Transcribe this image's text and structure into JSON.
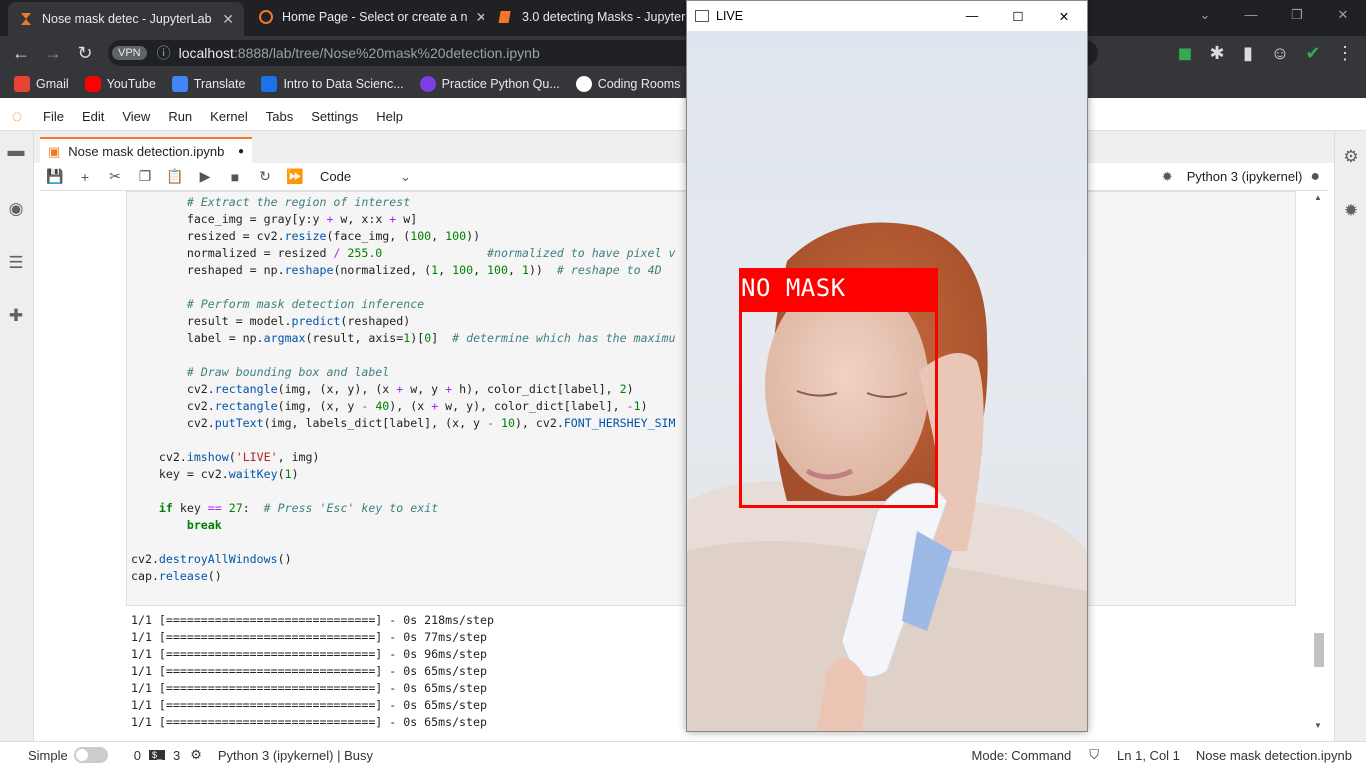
{
  "browser": {
    "tabs": [
      {
        "title": "Nose mask detec - JupyterLab",
        "active": true
      },
      {
        "title": "Home Page - Select or create a n",
        "active": false
      },
      {
        "title": "3.0 detecting Masks - Jupyter N",
        "active": false
      }
    ],
    "tab_close": "✕",
    "url_host": "localhost",
    "url_rest": ":8888/lab/tree/Nose%20mask%20detection.ipynb",
    "vpn_label": "VPN",
    "bookmarks": [
      {
        "label": "Gmail",
        "color": "#ea4335"
      },
      {
        "label": "YouTube",
        "color": "#ff0000"
      },
      {
        "label": "Translate",
        "color": "#4285f4"
      },
      {
        "label": "Intro to Data Scienc...",
        "color": "#1a73e8"
      },
      {
        "label": "Practice Python Qu...",
        "color": "#7b3fe4"
      },
      {
        "label": "Coding Rooms",
        "color": "#ffffff"
      }
    ]
  },
  "jupyter": {
    "menu": [
      "File",
      "Edit",
      "View",
      "Run",
      "Kernel",
      "Tabs",
      "Settings",
      "Help"
    ],
    "doc_tab": "Nose mask detection.ipynb",
    "cell_type": "Code",
    "kernel_name": "Python 3 (ipykernel)",
    "output_lines": [
      "1/1 [==============================] - 0s 218ms/step",
      "1/1 [==============================] - 0s 77ms/step",
      "1/1 [==============================] - 0s 96ms/step",
      "1/1 [==============================] - 0s 65ms/step",
      "1/1 [==============================] - 0s 65ms/step",
      "1/1 [==============================] - 0s 65ms/step",
      "1/1 [==============================] - 0s 65ms/step"
    ]
  },
  "statusbar": {
    "simple": "Simple",
    "zero": "0",
    "terminals": "3",
    "kernel_status": "Python 3 (ipykernel) | Busy",
    "mode": "Mode: Command",
    "position": "Ln 1, Col 1",
    "filename": "Nose mask detection.ipynb"
  },
  "live_window": {
    "title": "LIVE",
    "detection_label": "NO MASK",
    "box_color": "#ff0000"
  }
}
